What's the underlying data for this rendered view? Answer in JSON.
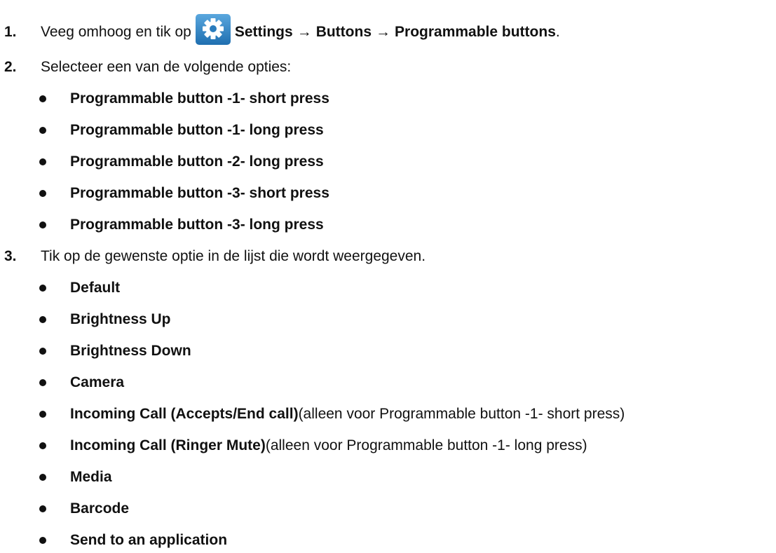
{
  "step1": {
    "number": "1.",
    "text_before": "Veeg omhoog en tik op",
    "icon": "settings-gear-icon",
    "path_settings": "Settings",
    "arrow1": "→",
    "path_buttons": "Buttons",
    "arrow2": "→",
    "path_programmable": "Programmable buttons",
    "end": "."
  },
  "step2": {
    "number": "2.",
    "text": "Selecteer een van de volgende opties:",
    "options": [
      "Programmable button -1- short press",
      "Programmable button -1- long press",
      "Programmable button -2- long press",
      "Programmable button -3- short press",
      "Programmable button -3- long press"
    ]
  },
  "step3": {
    "number": "3.",
    "text": "Tik op de gewenste optie in de lijst die wordt weergegeven.",
    "options": [
      {
        "bold": "Default",
        "note": ""
      },
      {
        "bold": "Brightness Up",
        "note": ""
      },
      {
        "bold": "Brightness Down",
        "note": ""
      },
      {
        "bold": "Camera",
        "note": ""
      },
      {
        "bold": "Incoming Call (Accepts/End call)",
        "note": "(alleen voor Programmable button -1- short press)"
      },
      {
        "bold": "Incoming Call (Ringer Mute)",
        "note": "(alleen voor Programmable button -1- long press)"
      },
      {
        "bold": "Media",
        "note": ""
      },
      {
        "bold": "Barcode",
        "note": ""
      },
      {
        "bold": "Send to an application",
        "note": ""
      }
    ]
  },
  "colors": {
    "text": "#111111",
    "icon_bg": "#2f86c8",
    "icon_fg": "#ffffff"
  }
}
